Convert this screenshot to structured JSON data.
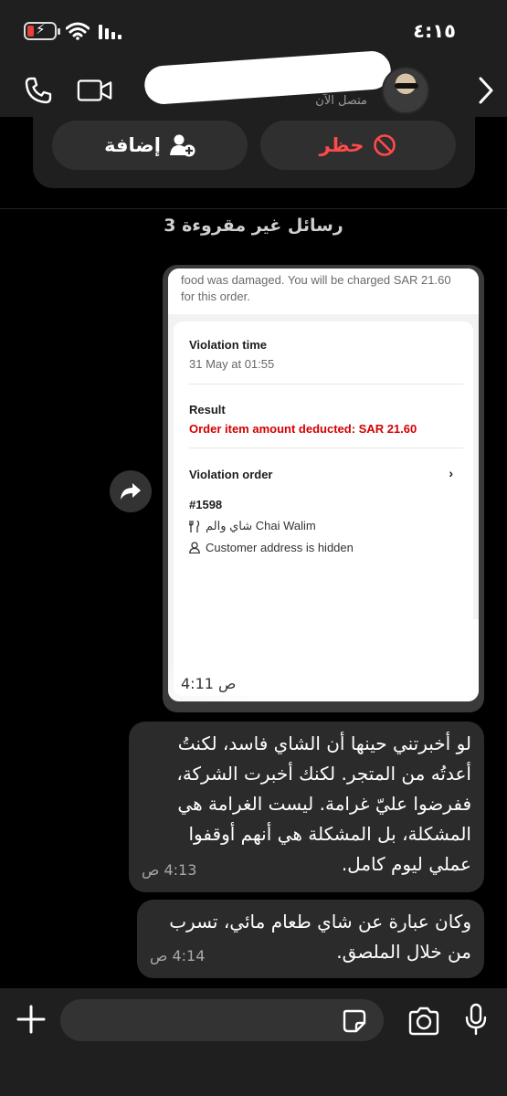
{
  "status_bar": {
    "time": "٤:١٥",
    "battery_level": 0.15
  },
  "header": {
    "contact_status": "متصل الآن"
  },
  "actions": {
    "add_label": "إضافة",
    "block_label": "حظر"
  },
  "unread_banner": "3 رسائل غير مقروءة",
  "forwarded_screenshot": {
    "top_text_line1": "food was damaged. You will be charged SAR 21.60",
    "top_text_line2": "for this order.",
    "violation_time_label": "Violation time",
    "violation_time_value": "31 May at 01:55",
    "result_label": "Result",
    "result_value": "Order item amount deducted: SAR 21.60",
    "violation_order_label": "Violation order",
    "order_number": "#1598",
    "store_name": "شاي والم Chai Walim",
    "address_text": "Customer address is hidden",
    "time": "4:11 ص"
  },
  "messages": [
    {
      "lines": [
        "لو أخبرتني حينها أن الشاي فاسد، لكنتُ",
        "أعدتُه من المتجر. لكنك أخبرت الشركة،",
        "ففرضوا عليّ غرامة. ليست الغرامة هي",
        "المشكلة، بل المشكلة هي أنهم أوقفوا",
        "عملي ليوم كامل."
      ],
      "time": "4:13 ص"
    },
    {
      "lines": [
        "وكان عبارة عن شاي طعام مائي، تسرب",
        "من خلال الملصق."
      ],
      "time": "4:14 ص"
    }
  ],
  "input": {
    "value": "",
    "placeholder": ""
  }
}
